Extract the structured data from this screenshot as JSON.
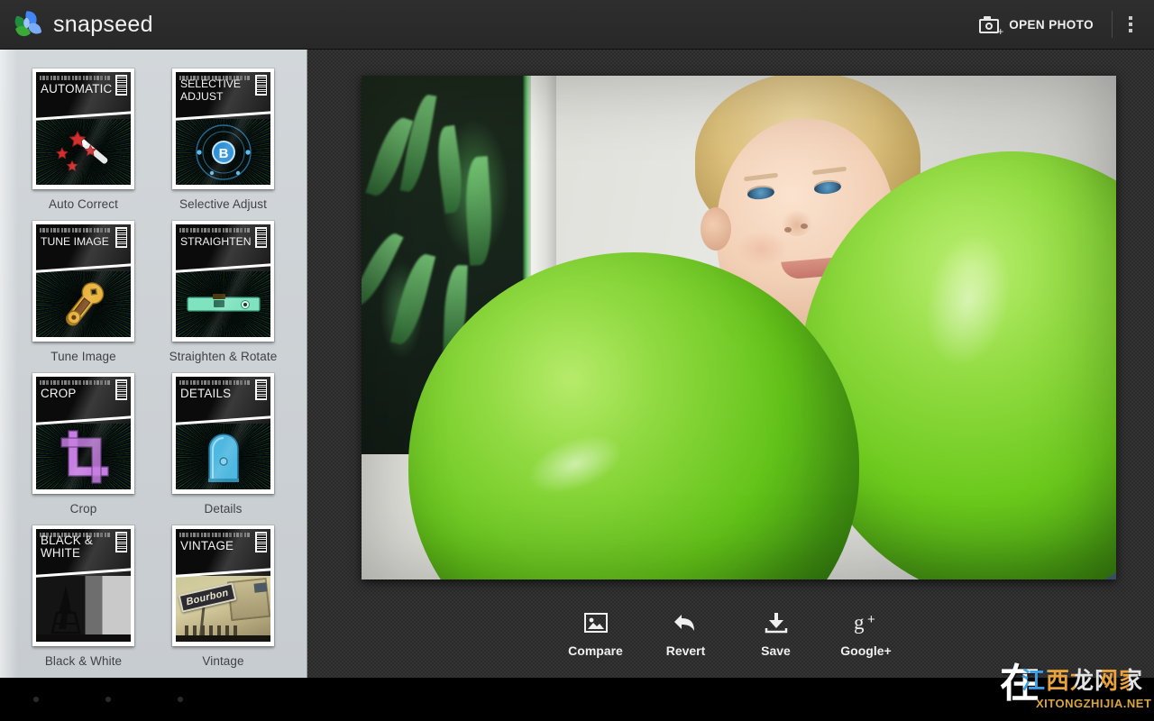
{
  "app": {
    "brand": "snapseed",
    "logo_colors": [
      "#3ba935",
      "#4285f4",
      "#7baaf7",
      "#1e8e3e"
    ]
  },
  "actionbar": {
    "open_photo_label": "OPEN PHOTO",
    "open_photo_icon": "camera-add-icon",
    "overflow_icon": "overflow-menu-icon"
  },
  "sidebar": {
    "filters": [
      {
        "label": "Auto Correct",
        "card_title": "AUTOMATIC",
        "icon": "magic-wand-icon",
        "style": "wand"
      },
      {
        "label": "Selective Adjust",
        "card_title": "SELECTIVE ADJUST",
        "icon": "control-point-b-icon",
        "style": "bpoint"
      },
      {
        "label": "Tune Image",
        "card_title": "TUNE IMAGE",
        "icon": "wrench-icon",
        "style": "wrench"
      },
      {
        "label": "Straighten & Rotate",
        "card_title": "STRAIGHTEN",
        "icon": "spirit-level-icon",
        "style": "level"
      },
      {
        "label": "Crop",
        "card_title": "CROP",
        "icon": "crop-marks-icon",
        "style": "crop"
      },
      {
        "label": "Details",
        "card_title": "DETAILS",
        "icon": "pencil-sharpener-icon",
        "style": "sharpener"
      },
      {
        "label": "Black & White",
        "card_title": "BLACK & WHITE",
        "icon": "eiffel-tower-photo",
        "style": "bw"
      },
      {
        "label": "Vintage",
        "card_title": "VINTAGE",
        "icon": "bourbon-street-photo",
        "style": "vintage",
        "sign_text": "Bourbon"
      }
    ]
  },
  "workspace": {
    "photo_description": "Young blond boy looking up between two large green balloons"
  },
  "toolbar": {
    "buttons": [
      {
        "label": "Compare",
        "icon": "image-compare-icon"
      },
      {
        "label": "Revert",
        "icon": "undo-arrow-icon"
      },
      {
        "label": "Save",
        "icon": "download-save-icon"
      },
      {
        "label": "Google+",
        "icon": "google-plus-icon"
      }
    ]
  },
  "navbar": {
    "buttons": [
      "back-dot",
      "home-dot",
      "recents-dot"
    ]
  },
  "watermark": {
    "logo_char": "在",
    "chinese": "江西龙网家",
    "site": "XITONGZHIJIA.NET"
  }
}
